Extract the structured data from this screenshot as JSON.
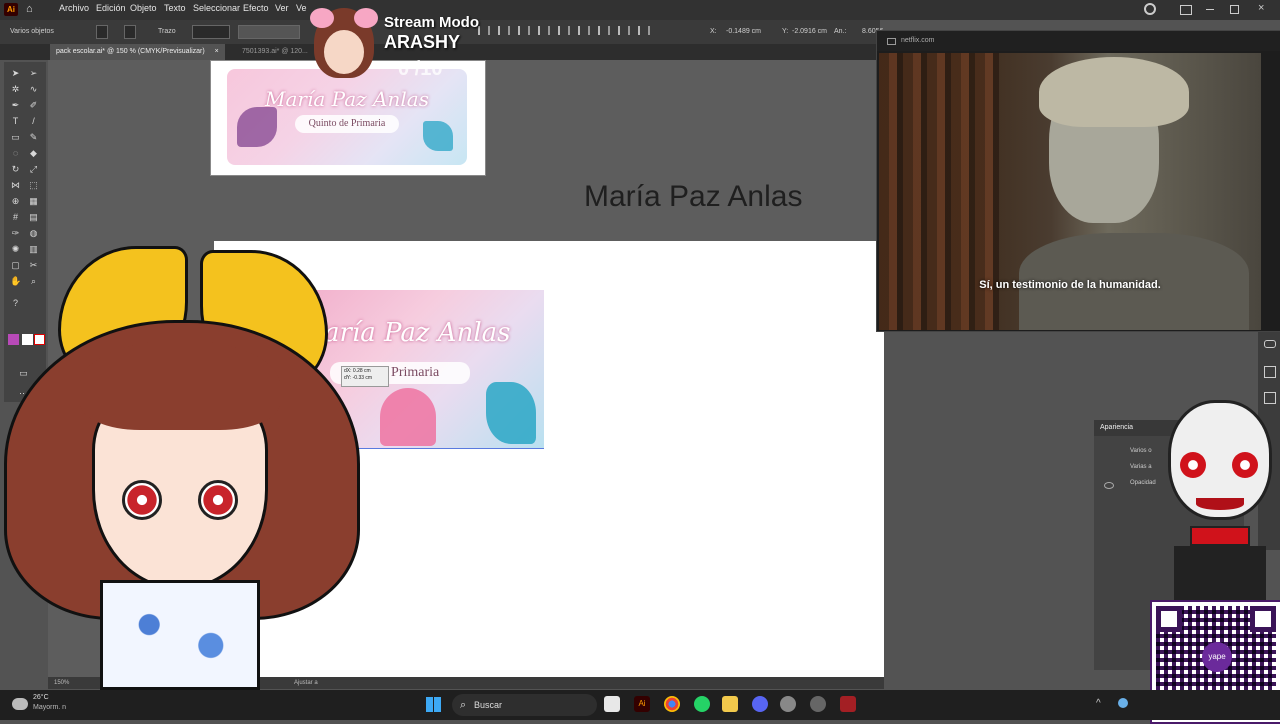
{
  "app": {
    "logo": "Ai",
    "menu": [
      "Archivo",
      "Edición",
      "Objeto",
      "Texto",
      "Seleccionar",
      "Efecto",
      "Ver",
      "Ve"
    ]
  },
  "controlbar": {
    "selection_label": "Varios objetos",
    "stroke_label": "Trazo",
    "x_label": "X:",
    "x_value": "-0.1489 cm",
    "y_label": "Y:",
    "y_value": "-2.0916 cm",
    "w_label": "An.:",
    "w_value": "8.6056"
  },
  "tabs": [
    {
      "label": "pack escolar.ai* @ 150 % (CMYK/Previsualizar)",
      "close": "×"
    },
    {
      "label": "7501393.ai* @ 120...",
      "close": "×"
    }
  ],
  "artwork": {
    "card_name": "María Paz Anlas",
    "card_grade": "Quinto de Primaria",
    "big_title": "María Paz Anlas",
    "selected_name": "aría Paz Anlas",
    "selected_grade": "Q         de Primaria",
    "tooltip_dx": "dX: 0.28 cm",
    "tooltip_dy": "dY: -0.33 cm"
  },
  "statusbar": {
    "zoom": "150%",
    "label": "Ajustar a"
  },
  "stream": {
    "title": "Stream Modo",
    "name": "ARASHY",
    "count": "0 /10"
  },
  "netflix": {
    "url": "netflix.com",
    "subtitle": "Sí, un testimonio de la humanidad."
  },
  "apariencia": {
    "title": "Apariencia",
    "row1": "Varios o",
    "row2": "Varias a",
    "row3": "Opacidad"
  },
  "taskbar": {
    "search_placeholder": "Buscar",
    "weather_temp": "26°C",
    "weather_text": "Mayorm. n"
  },
  "qr_label": "yape",
  "colors": {
    "ai_orange": "#ff9a00",
    "bow_yellow": "#f4c21e",
    "card_pink": "#f2b2cd"
  }
}
